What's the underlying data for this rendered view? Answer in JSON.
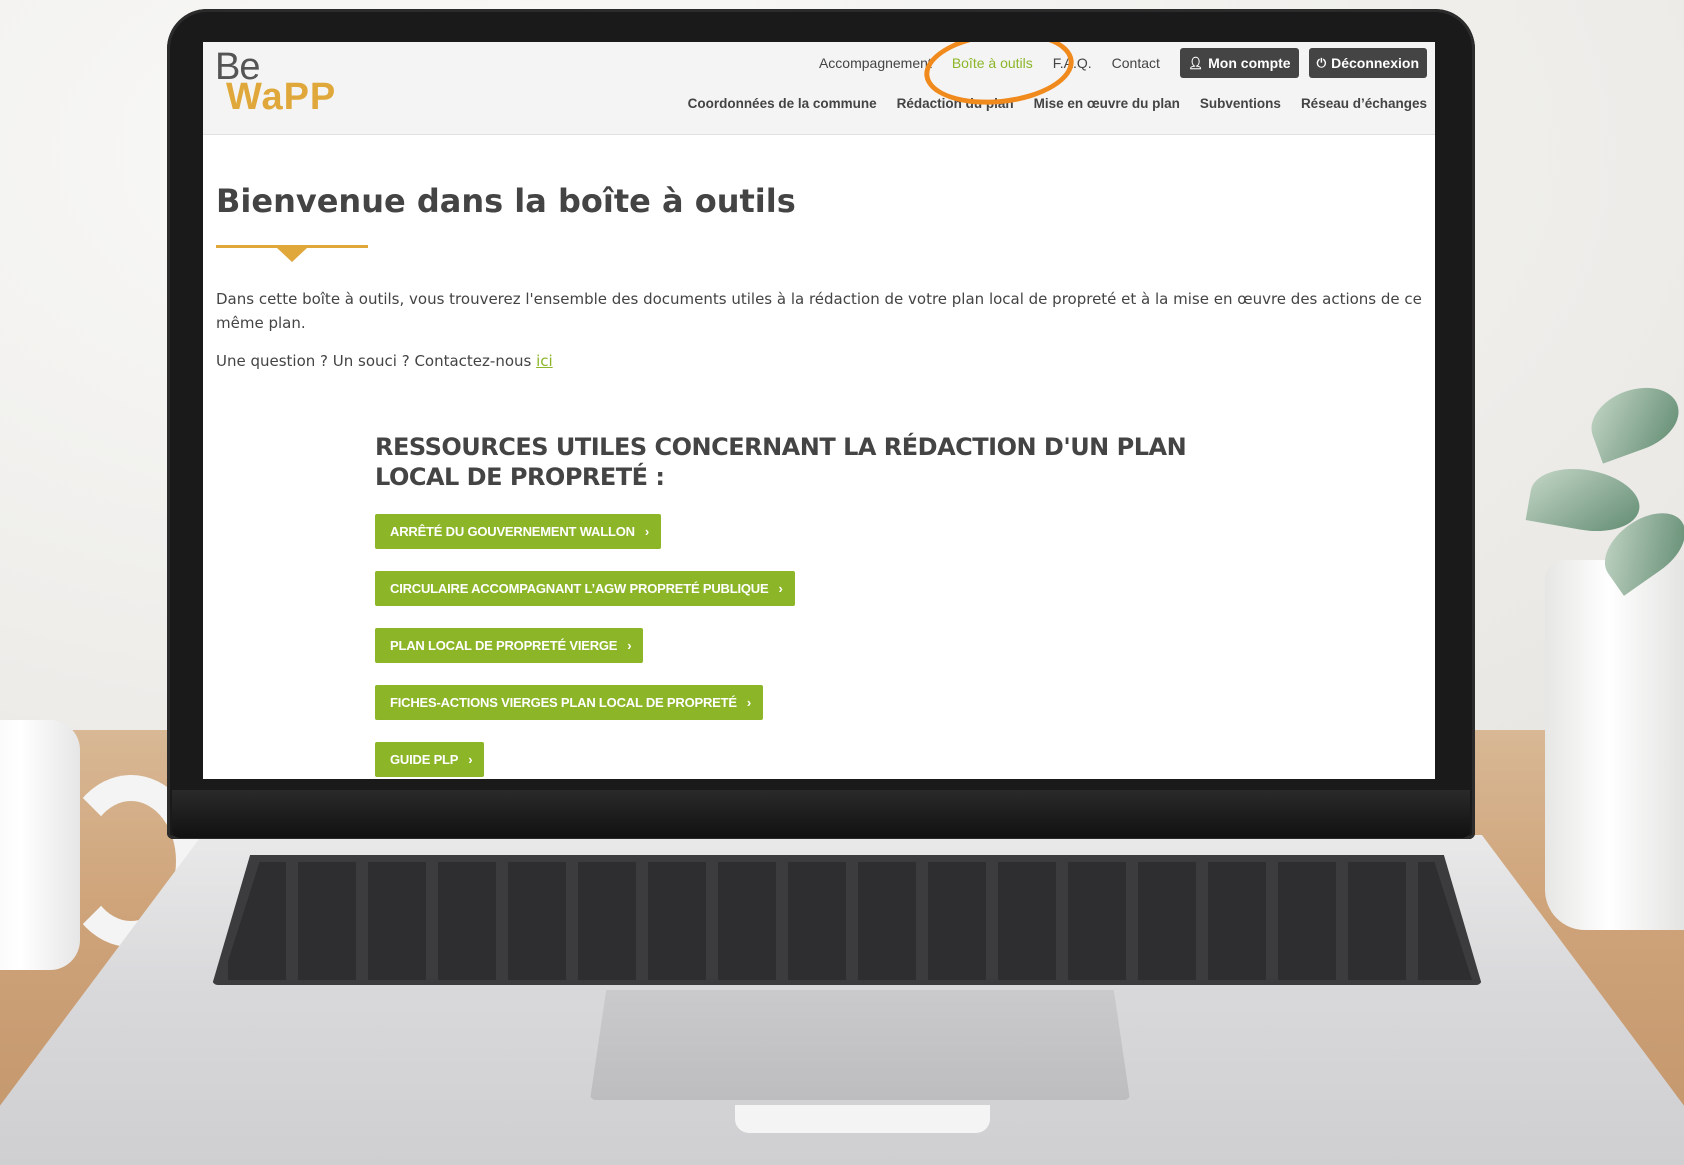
{
  "logo": {
    "line1": "Be",
    "line2": "WaPP"
  },
  "topnav": {
    "items": [
      {
        "label": "Accompagnement",
        "active": false
      },
      {
        "label": "Boîte à outils",
        "active": true
      },
      {
        "label": "F.A.Q.",
        "active": false
      },
      {
        "label": "Contact",
        "active": false
      }
    ],
    "account_label": "Mon compte",
    "account_icon": "user-icon",
    "logout_label": "Déconnexion",
    "logout_icon": "power-icon"
  },
  "mainnav": {
    "items": [
      "Coordonnées de la commune",
      "Rédaction du plan",
      "Mise en œuvre du plan",
      "Subventions",
      "Réseau d’échanges"
    ]
  },
  "page": {
    "title": "Bienvenue dans la boîte à outils",
    "intro": "Dans cette boîte à outils, vous trouverez l'ensemble des documents utiles à la rédaction de votre plan local de propreté et à la mise en œuvre des actions de ce même plan.",
    "contact_prefix": "Une question ? Un souci ? Contactez-nous ",
    "contact_link": "ici"
  },
  "resources": {
    "heading": "RESSOURCES UTILES CONCERNANT LA RÉDACTION D'UN PLAN LOCAL DE PROPRETÉ :",
    "buttons": [
      "ARRÊTÉ DU GOUVERNEMENT WALLON",
      "CIRCULAIRE ACCOMPAGNANT L’AGW PROPRETÉ PUBLIQUE",
      "PLAN LOCAL DE PROPRETÉ VIERGE",
      "FICHES-ACTIONS VIERGES PLAN LOCAL DE PROPRETÉ",
      "GUIDE PLP"
    ]
  },
  "colors": {
    "accent_green": "#8cb628",
    "brand_gold": "#e0a83b",
    "highlight_orange": "#f08a1c",
    "dark_button": "#444444"
  }
}
